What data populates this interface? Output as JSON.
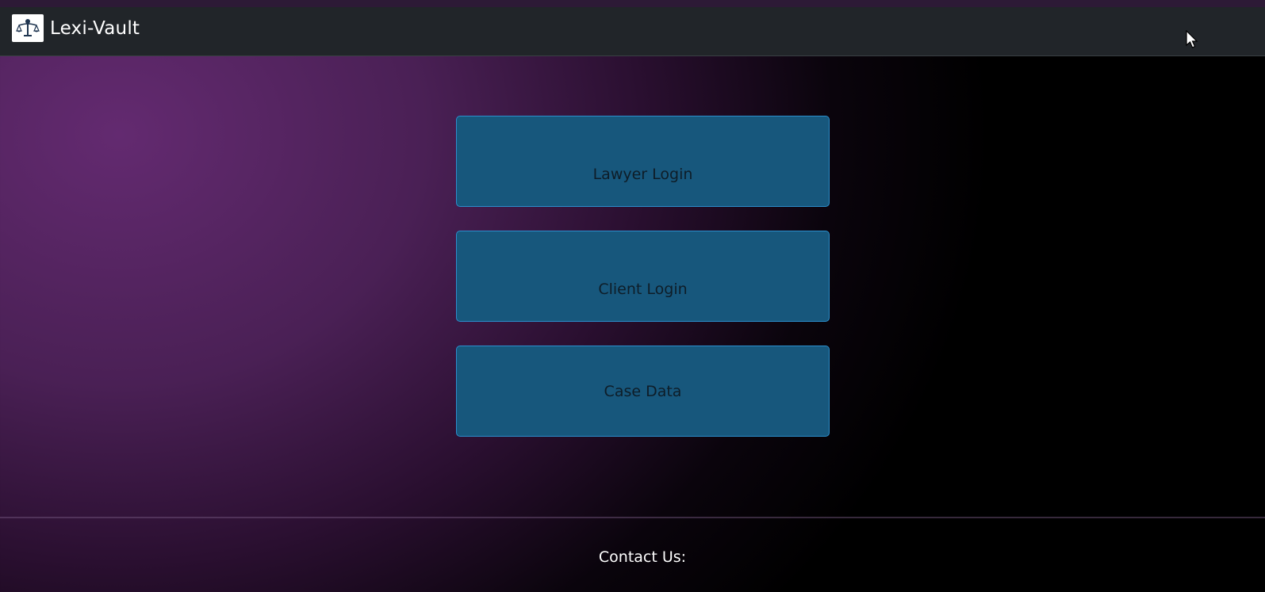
{
  "navbar": {
    "brand_name": "Lexi-Vault",
    "logo_icon": "scales-of-justice-icon"
  },
  "main": {
    "buttons": [
      {
        "label": "Lawyer Login"
      },
      {
        "label": "Client Login"
      },
      {
        "label": "Case Data"
      }
    ]
  },
  "footer": {
    "contact_label": "Contact Us:"
  },
  "colors": {
    "navbar_bg": "#212529",
    "button_bg": "#17577c",
    "button_border": "#2b8fcd",
    "gradient_start": "#632a70",
    "gradient_end": "#000000"
  }
}
